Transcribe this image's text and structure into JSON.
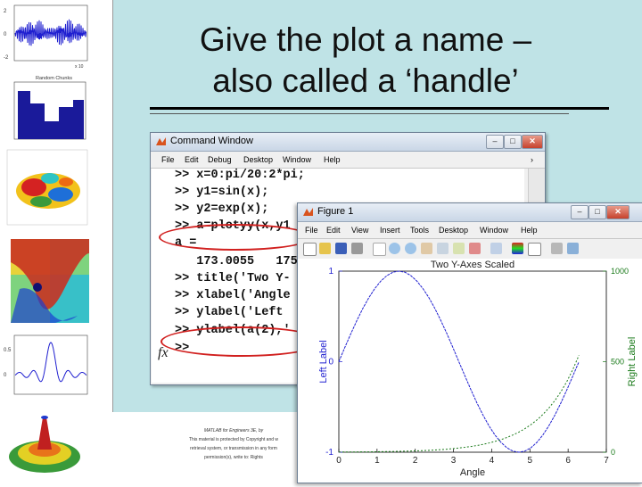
{
  "slide": {
    "title_line1": "Give the plot a name –",
    "title_line2": "also called a ‘handle’",
    "caption_line1": "MATLAB for Engineers 3E, by",
    "caption_line2": "This material is protected by Copyright and w",
    "caption_line3": "retrieval system, or transmission in any form",
    "caption_line4": "permission(s), write to: Rights"
  },
  "thumbnails": {
    "thumb2_label": "Random Chunks",
    "thumb1_axis_x": "x 10",
    "colors": {
      "signal": "#1f1fd0",
      "bars": "#1a1a9a"
    }
  },
  "command_window": {
    "title": "Command Window",
    "menu": [
      "File",
      "Edit",
      "Debug",
      "Desktop",
      "Window",
      "Help"
    ],
    "lines": [
      ">> x=0:pi/20:2*pi;",
      ">> y1=sin(x);",
      ">> y2=exp(x);",
      ">> a=plotyy(x,y1",
      "a =",
      "   173.0055   175.",
      ">> title('Two Y-",
      ">> xlabel('Angle",
      ">> ylabel('Left ",
      ">> ylabel(a(2),'",
      ">>"
    ],
    "fx_glyph": "fx",
    "buttons": {
      "min": "–",
      "max": "□",
      "close": "✕"
    }
  },
  "figure_window": {
    "title": "Figure 1",
    "menu": [
      "File",
      "Edit",
      "View",
      "Insert",
      "Tools",
      "Desktop",
      "Window",
      "Help"
    ],
    "buttons": {
      "min": "–",
      "max": "□",
      "close": "✕"
    }
  },
  "chart_data": {
    "type": "line",
    "title": "Two Y-Axes Scaled",
    "xlabel": "Angle",
    "ylabel": "Left Label",
    "ylabel_right": "Right Label",
    "xlim": [
      0,
      7
    ],
    "ylim": [
      -1,
      1
    ],
    "ylim_right": [
      0,
      1000
    ],
    "x_ticks": [
      "0",
      "1",
      "2",
      "3",
      "4",
      "5",
      "6",
      "7"
    ],
    "y_ticks": [
      "-1",
      "0",
      "1"
    ],
    "y_ticks_right": [
      "0",
      "500",
      "1000"
    ],
    "grid": false,
    "series": [
      {
        "name": "",
        "axis": "left",
        "color": "#1f1fd0",
        "function": "sin",
        "x_range": [
          0,
          6.2832
        ]
      },
      {
        "name": "",
        "axis": "right",
        "color": "#1a7a1a",
        "function": "exp",
        "x_range": [
          0,
          6.2832
        ]
      }
    ]
  }
}
